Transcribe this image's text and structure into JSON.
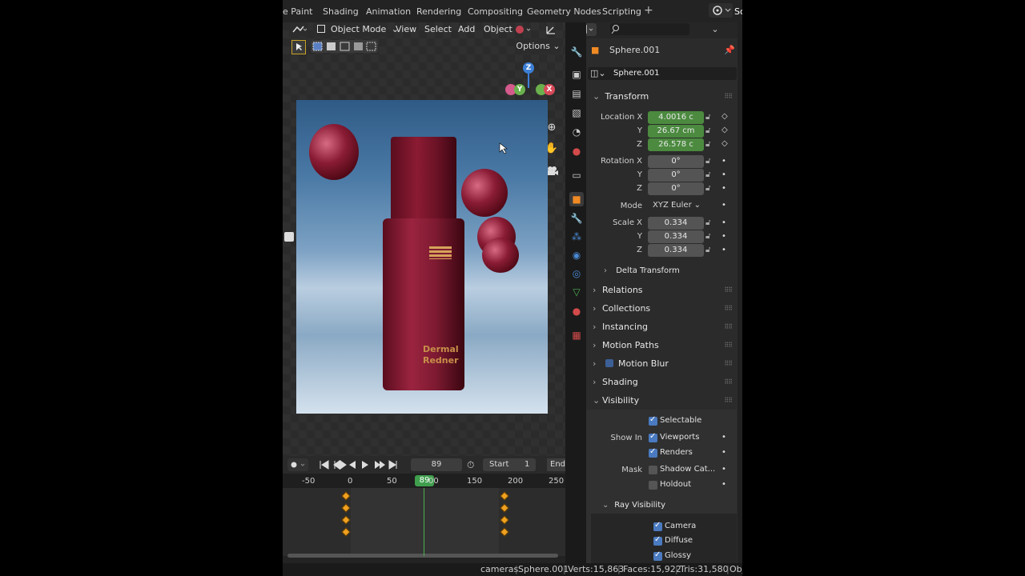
{
  "workspace_tabs": [
    "e Paint",
    "Shading",
    "Animation",
    "Rendering",
    "Compositing",
    "Geometry Nodes",
    "Scripting"
  ],
  "top_right": {
    "label": "Sc"
  },
  "viewport": {
    "mode": "Object Mode",
    "menus": [
      "View",
      "Select",
      "Add",
      "Object"
    ],
    "options_label": "Options",
    "gizmo": {
      "z": "Z",
      "y": "Y",
      "x": "X"
    },
    "render_text": "Dermal Redner"
  },
  "timeline": {
    "current_frame": "89",
    "start_label": "Start",
    "start_value": "1",
    "end_label": "End",
    "ruler_ticks": [
      "-50",
      "0",
      "50",
      "89",
      "00",
      "150",
      "200",
      "250"
    ]
  },
  "status_bar": {
    "collection": "cameras",
    "object": "Sphere.001",
    "verts": "Verts:15,863",
    "faces": "Faces:15,922",
    "tris": "Tris:31,580",
    "extra": "Obj"
  },
  "properties": {
    "object_title": "Sphere.001",
    "object_name_field": "Sphere.001",
    "transform": {
      "title": "Transform",
      "location_label": "Location X",
      "location": [
        "4.0016 c",
        "26.67 cm",
        "26.578 c"
      ],
      "rotation_label": "Rotation X",
      "rotation": [
        "0°",
        "0°",
        "0°"
      ],
      "mode_label": "Mode",
      "mode_value": "XYZ Euler",
      "scale_label": "Scale X",
      "scale": [
        "0.334",
        "0.334",
        "0.334"
      ],
      "axis_y": "Y",
      "axis_z": "Z",
      "delta": "Delta Transform"
    },
    "panels": [
      "Relations",
      "Collections",
      "Instancing",
      "Motion Paths",
      "Motion Blur",
      "Shading",
      "Visibility"
    ],
    "visibility": {
      "selectable": "Selectable",
      "show_in_label": "Show In",
      "viewports": "Viewports",
      "renders": "Renders",
      "mask_label": "Mask",
      "shadow_catcher": "Shadow Cat...",
      "holdout": "Holdout",
      "ray_visibility": "Ray Visibility",
      "camera": "Camera",
      "diffuse": "Diffuse",
      "glossy": "Glossy"
    }
  },
  "colors": {
    "accent_green": "#4b8a3f",
    "checkbox_blue": "#4a7ac0",
    "keyframe": "#f0a020"
  }
}
